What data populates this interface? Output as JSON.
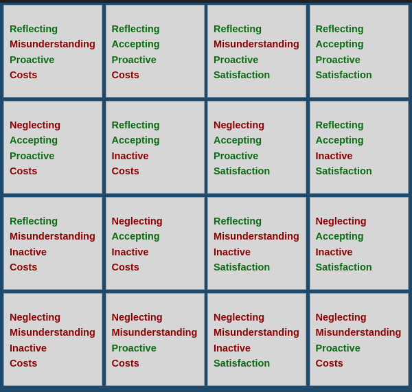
{
  "colors": {
    "positive": "#0b6b12",
    "negative": "#8b0000",
    "border": "#1f4a6b",
    "cell": "#d6d6d6"
  },
  "positive_words": [
    "Reflecting",
    "Accepting",
    "Proactive",
    "Satisfaction"
  ],
  "cells": [
    [
      "Reflecting",
      "Misunderstanding",
      "Proactive",
      "Costs"
    ],
    [
      "Reflecting",
      "Accepting",
      "Proactive",
      "Costs"
    ],
    [
      "Reflecting",
      "Misunderstanding",
      "Proactive",
      "Satisfaction"
    ],
    [
      "Reflecting",
      "Accepting",
      "Proactive",
      "Satisfaction"
    ],
    [
      "Neglecting",
      "Accepting",
      "Proactive",
      "Costs"
    ],
    [
      "Reflecting",
      "Accepting",
      "Inactive",
      "Costs"
    ],
    [
      "Neglecting",
      "Accepting",
      "Proactive",
      "Satisfaction"
    ],
    [
      "Reflecting",
      "Accepting",
      "Inactive",
      "Satisfaction"
    ],
    [
      "Reflecting",
      "Misunderstanding",
      "Inactive",
      "Costs"
    ],
    [
      "Neglecting",
      "Accepting",
      "Inactive",
      "Costs"
    ],
    [
      "Reflecting",
      "Misunderstanding",
      "Inactive",
      "Satisfaction"
    ],
    [
      "Neglecting",
      "Accepting",
      "Inactive",
      "Satisfaction"
    ],
    [
      "Neglecting",
      "Misunderstanding",
      "Inactive",
      "Costs"
    ],
    [
      "Neglecting",
      "Misunderstanding",
      "Proactive",
      "Costs"
    ],
    [
      "Neglecting",
      "Misunderstanding",
      "Inactive",
      "Satisfaction"
    ],
    [
      "Neglecting",
      "Misunderstanding",
      "Proactive",
      "Costs"
    ]
  ]
}
